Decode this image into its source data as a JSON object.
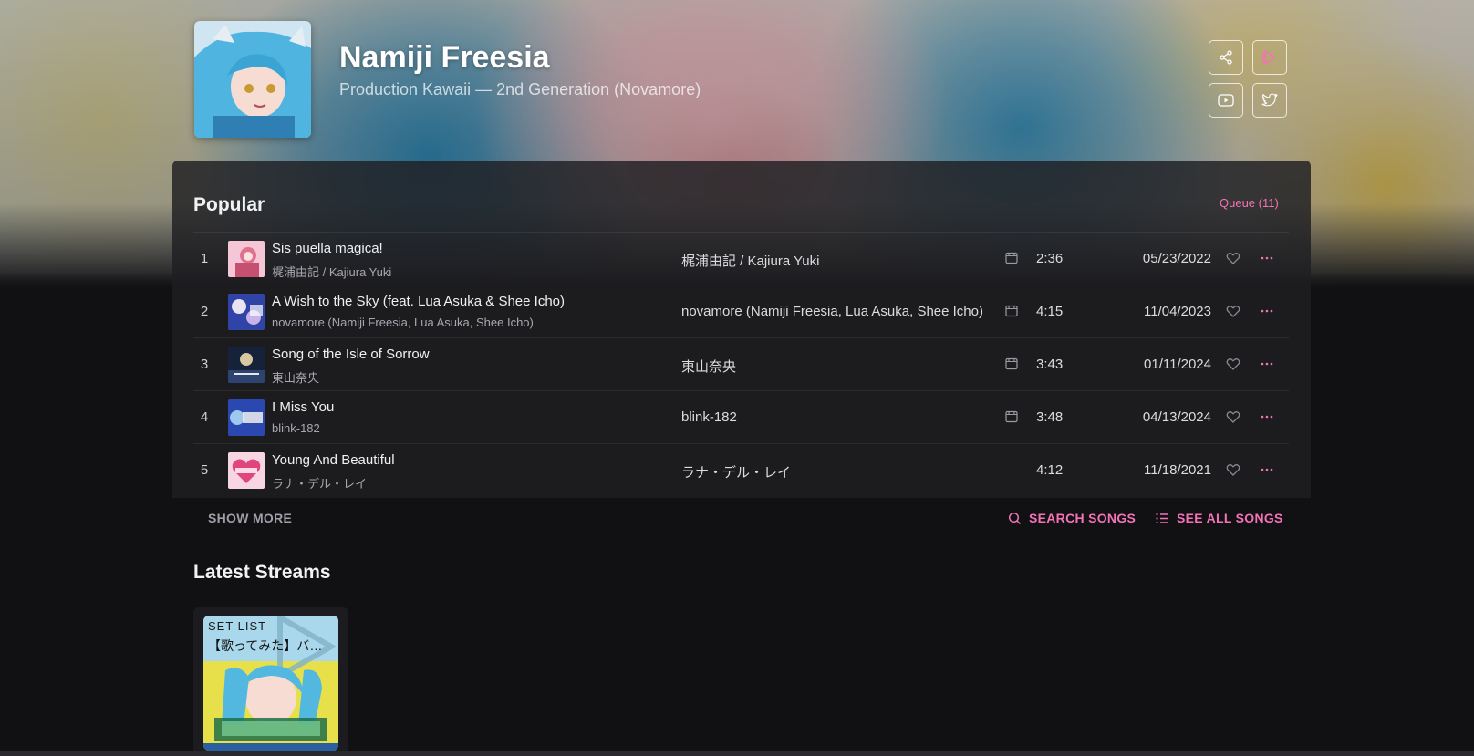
{
  "artist": {
    "name": "Namiji Freesia",
    "subtitle": "Production Kawaii — 2nd Generation (Novamore)"
  },
  "header_icons": [
    "share-icon",
    "play-icon",
    "youtube-icon",
    "twitter-icon"
  ],
  "popular": {
    "title": "Popular",
    "queue_label": "Queue (11)",
    "songs": [
      {
        "index": "1",
        "title": "Sis puella magica!",
        "artist_small": "梶浦由記 / Kajiura Yuki",
        "artist": "梶浦由記 / Kajiura Yuki",
        "has_mv": true,
        "duration": "2:36",
        "date": "05/23/2022",
        "thumb_color": "#e58aa8"
      },
      {
        "index": "2",
        "title": "A Wish to the Sky (feat. Lua Asuka & Shee Icho)",
        "artist_small": "novamore (Namiji Freesia, Lua Asuka, Shee Icho)",
        "artist": "novamore (Namiji Freesia, Lua Asuka, Shee Icho)",
        "has_mv": true,
        "duration": "4:15",
        "date": "11/04/2023",
        "thumb_color": "#5a6fd0"
      },
      {
        "index": "3",
        "title": "Song of the Isle of Sorrow",
        "artist_small": "東山奈央",
        "artist": "東山奈央",
        "has_mv": true,
        "duration": "3:43",
        "date": "01/11/2024",
        "thumb_color": "#1c2a44"
      },
      {
        "index": "4",
        "title": "I Miss You",
        "artist_small": "blink-182",
        "artist": "blink-182",
        "has_mv": true,
        "duration": "3:48",
        "date": "04/13/2024",
        "thumb_color": "#2f4fb8"
      },
      {
        "index": "5",
        "title": "Young And Beautiful",
        "artist_small": "ラナ・デル・レイ",
        "artist": "ラナ・デル・レイ",
        "has_mv": false,
        "duration": "4:12",
        "date": "11/18/2021",
        "thumb_color": "#e2457e"
      }
    ],
    "show_more": "SHOW MORE",
    "search_songs": "SEARCH SONGS",
    "see_all_songs": "SEE ALL SONGS"
  },
  "latest_streams": {
    "title": "Latest Streams",
    "items": [
      {
        "label": "SET LIST",
        "title": "【歌ってみた】バニ…"
      }
    ]
  },
  "colors": {
    "accent": "#f472b6",
    "background": "#111114",
    "panel": "#1e1e22"
  }
}
